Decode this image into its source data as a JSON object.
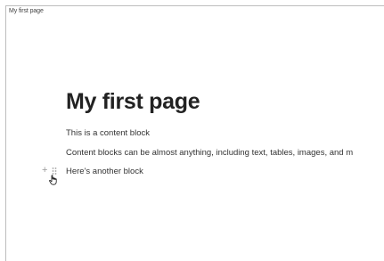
{
  "window": {
    "title": "My first page"
  },
  "page": {
    "title": "My first page",
    "blocks": [
      "This is a content block",
      "Content blocks can be almost anything, including text, tables, images, and m",
      "Here's another block"
    ]
  },
  "icons": {
    "add": "plus-icon",
    "drag": "drag-handle-icon",
    "cursor": "hand-pointer-icon"
  }
}
